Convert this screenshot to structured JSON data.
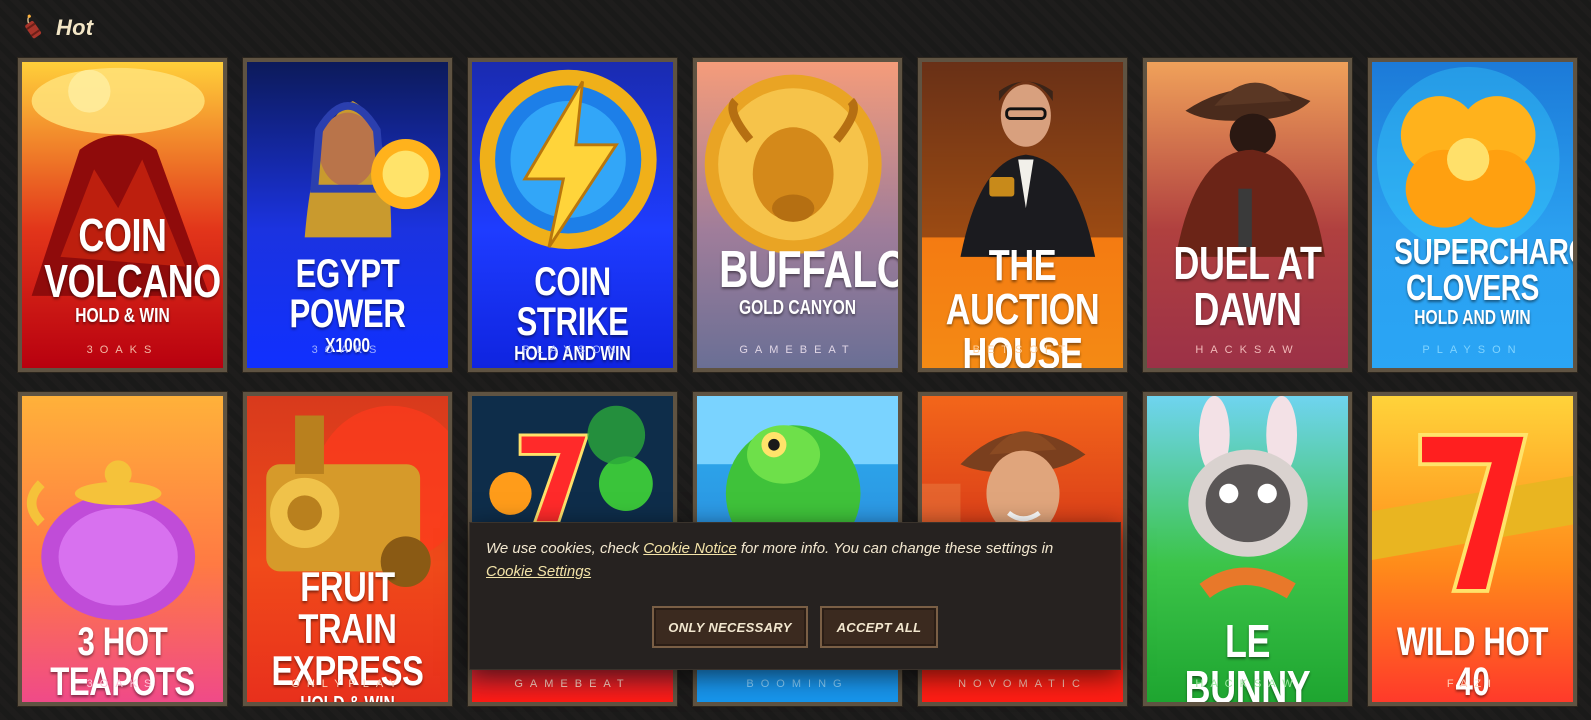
{
  "section": {
    "title": "Hot",
    "icon": "dynamite-icon"
  },
  "games": [
    {
      "title": "COIN\nVOLCANO",
      "sub": "HOLD & WIN",
      "provider": "3OAKS",
      "bg": [
        "#ffcf3a",
        "#e2351a",
        "#b8000f"
      ],
      "provider_color": "#f3b9a6",
      "art": "volcano"
    },
    {
      "title": "EGYPT POWER",
      "sub": "X1000",
      "provider": "3OAKS",
      "bg": [
        "#0c1a5a",
        "#1b33e0",
        "#1030ff"
      ],
      "provider_color": "#9fb0ff",
      "art": "pharaoh"
    },
    {
      "title": "COIN STRIKE",
      "sub": "HOLD AND WIN",
      "provider": "PLAYSON",
      "bg": [
        "#1a2bb0",
        "#1e3cff",
        "#0f24e0"
      ],
      "provider_color": "#a7b6ff",
      "art": "lightning"
    },
    {
      "title": "BUFFALO",
      "sub": "GOLD CANYON",
      "provider": "GAMEBEAT",
      "bg": [
        "#f59c7a",
        "#a07d9a",
        "#6a6f95"
      ],
      "provider_color": "#e0d6e6",
      "art": "buffalo"
    },
    {
      "title": "THE AUCTION\nHOUSE",
      "sub": "",
      "provider": "BETSOFT",
      "bg": [
        "#7b3b1c",
        "#f47a12",
        "#f48a14"
      ],
      "provider_color": "#ffcf9b",
      "art": "auctioneer"
    },
    {
      "title": "DUEL AT\nDAWN",
      "sub": "",
      "provider": "HACKSAW",
      "bg": [
        "#f0a15a",
        "#b0403f",
        "#9c3147"
      ],
      "provider_color": "#f1b9b9",
      "art": "cowboy"
    },
    {
      "title": "SUPERCHARGED\nCLOVERS",
      "sub": "HOLD AND WIN",
      "provider": "PLAYSON",
      "bg": [
        "#1c7ad8",
        "#2ba0f0",
        "#2aa5f5"
      ],
      "provider_color": "#7fd3ff",
      "art": "clover"
    },
    {
      "title": "3 HOT TEAPOTS",
      "sub": "",
      "provider": "3OAKS",
      "bg": [
        "#ffb13a",
        "#ff7a43",
        "#f04a88"
      ],
      "provider_color": "#ffc4d8",
      "art": "teapot"
    },
    {
      "title": "FRUIT TRAIN\nEXPRESS",
      "sub": "HOLD & WIN",
      "provider": "ONLYPLAY",
      "bg": [
        "#d83a1c",
        "#f04a1a",
        "#e8301c"
      ],
      "provider_color": "#ffcfb9",
      "art": "train"
    },
    {
      "title": "",
      "sub": "",
      "provider": "GAMEBEAT",
      "bg": [
        "#0f5d4d",
        "#1c3f8a",
        "#ff1a14"
      ],
      "provider_color": "#ffd2c4",
      "art": "sevens"
    },
    {
      "title": "",
      "sub": "",
      "provider": "BOOMING",
      "bg": [
        "#2cb0ee",
        "#2c8ee0",
        "#1695ec"
      ],
      "provider_color": "#8ad2ff",
      "art": "frog"
    },
    {
      "title": "",
      "sub": "",
      "provider": "NOVOMATIC",
      "bg": [
        "#f3661a",
        "#d43418",
        "#ff1c14"
      ],
      "provider_color": "#ffc4b4",
      "art": "explorer"
    },
    {
      "title": "LE BUNNY",
      "sub": "",
      "provider": "HACKSAW",
      "bg": [
        "#6fd4f0",
        "#3cc449",
        "#1ea530"
      ],
      "provider_color": "#9fe8a2",
      "art": "bunny"
    },
    {
      "title": "WILD HOT 40",
      "sub": "",
      "provider": "FAZI",
      "bg": [
        "#ffd33a",
        "#ff8c1a",
        "#ff3a2a"
      ],
      "provider_color": "#ffd0b6",
      "art": "seven"
    }
  ],
  "cookie": {
    "text_before": "We use cookies, check ",
    "link_notice": "Cookie Notice",
    "text_middle": " for more info. You can change these settings in ",
    "link_settings": "Cookie Settings",
    "btn_necessary": "ONLY NECESSARY",
    "btn_accept": "ACCEPT ALL"
  }
}
